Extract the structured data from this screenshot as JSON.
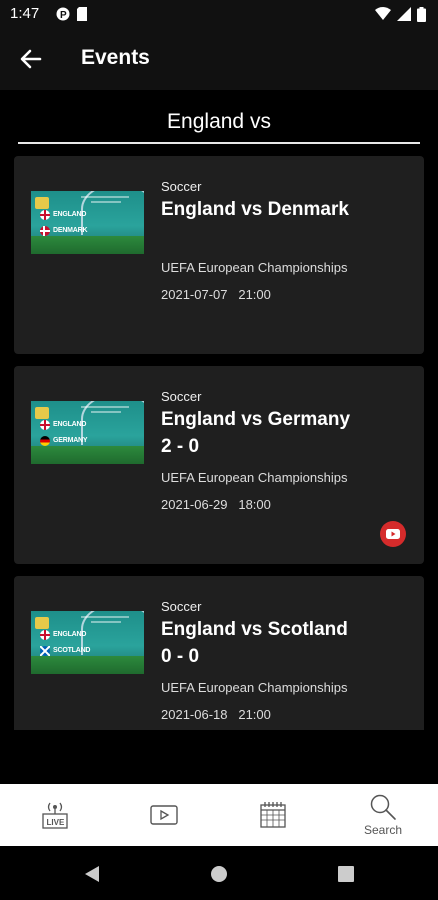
{
  "status": {
    "time": "1:47"
  },
  "header": {
    "title": "Events"
  },
  "search": {
    "query": "England vs"
  },
  "events": [
    {
      "sport": "Soccer",
      "title": "England vs Denmark",
      "score": "",
      "competition": "UEFA European Championships",
      "date": "2021-07-07",
      "time": "21:00",
      "has_video": false,
      "thumb": {
        "team1": "ENGLAND",
        "team2": "DENMARK"
      }
    },
    {
      "sport": "Soccer",
      "title": "England vs Germany",
      "score": "2 - 0",
      "competition": "UEFA European Championships",
      "date": "2021-06-29",
      "time": "18:00",
      "has_video": true,
      "thumb": {
        "team1": "ENGLAND",
        "team2": "GERMANY"
      }
    },
    {
      "sport": "Soccer",
      "title": "England vs Scotland",
      "score": "0 - 0",
      "competition": "UEFA European Championships",
      "date": "2021-06-18",
      "time": "21:00",
      "has_video": false,
      "thumb": {
        "team1": "ENGLAND",
        "team2": "SCOTLAND"
      }
    }
  ],
  "bottom_nav": {
    "live_icon_text": "LIVE",
    "search_label": "Search"
  },
  "colors": {
    "card": "#1f1f1f",
    "accent_red": "#d52b2b",
    "nav_bg": "#ffffff"
  }
}
